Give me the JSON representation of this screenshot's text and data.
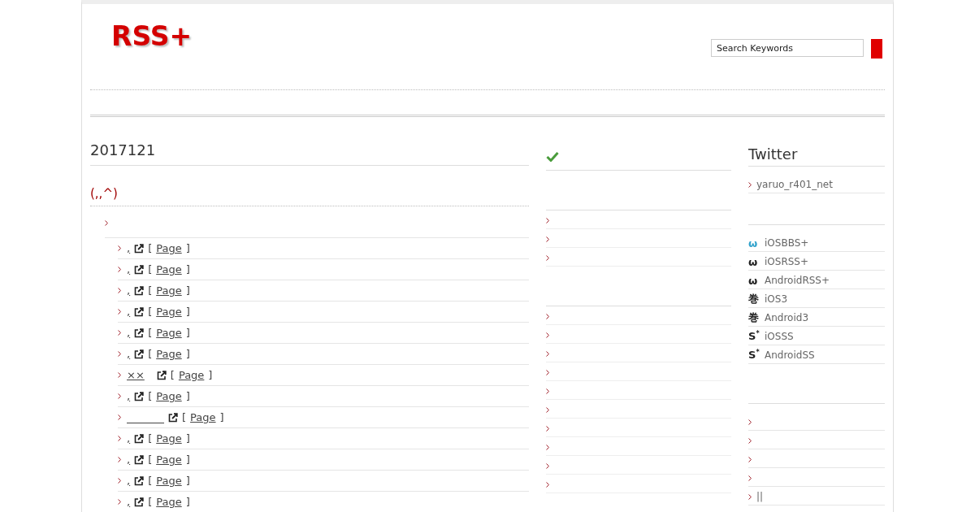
{
  "header": {
    "logo": "RSS+",
    "search": {
      "placeholder": "Search Keywords"
    }
  },
  "main": {
    "title": "2017121",
    "section_title": "(,,^)",
    "category": {
      "entries": [
        {
          "kind": "link",
          "title": ",",
          "open": "[",
          "link": "Page",
          "close": "]"
        },
        {
          "kind": "link",
          "title": ",",
          "open": "[",
          "link": "Page",
          "close": "]"
        },
        {
          "kind": "link",
          "title": ",",
          "open": "[",
          "link": "Page",
          "close": "]"
        },
        {
          "kind": "link",
          "title": ",",
          "open": "[",
          "link": "Page",
          "close": "]"
        },
        {
          "kind": "link",
          "title": ",",
          "open": "[",
          "link": "Page",
          "close": "]"
        },
        {
          "kind": "link",
          "title": ",",
          "open": "[",
          "link": "Page",
          "close": "]"
        },
        {
          "kind": "link",
          "title": "××",
          "open": "[",
          "link": "Page",
          "close": "]"
        },
        {
          "kind": "link",
          "title": ",",
          "open": "[",
          "link": "Page",
          "close": "]"
        },
        {
          "kind": "blank",
          "open": "[",
          "link": "Page",
          "close": "]"
        },
        {
          "kind": "link",
          "title": ",",
          "open": "[",
          "link": "Page",
          "close": "]"
        },
        {
          "kind": "link",
          "title": ",",
          "open": "[",
          "link": "Page",
          "close": "]"
        },
        {
          "kind": "link",
          "title": ",",
          "open": "[",
          "link": "Page",
          "close": "]"
        },
        {
          "kind": "link",
          "title": ",",
          "open": "[",
          "link": "Page",
          "close": "]"
        }
      ]
    }
  },
  "middle": {
    "lists": [
      [
        {
          "kind": "bullet"
        },
        {
          "kind": "bullet"
        },
        {
          "kind": "bullet"
        }
      ],
      [
        {
          "kind": "bullet"
        },
        {
          "kind": "bullet"
        },
        {
          "kind": "bullet"
        },
        {
          "kind": "bullet"
        },
        {
          "kind": "bullet"
        },
        {
          "kind": "bullet"
        },
        {
          "kind": "bullet"
        },
        {
          "kind": "bullet"
        },
        {
          "kind": "bullet"
        },
        {
          "kind": "bullet"
        }
      ]
    ]
  },
  "sidebar": {
    "title": "Twitter",
    "account": "yaruo_r401_net",
    "apps": [
      {
        "icon": "ω",
        "color": "#33a3cc",
        "label": "iOSBBS+"
      },
      {
        "icon": "ω",
        "color": "#222222",
        "label": "iOSRSS+"
      },
      {
        "icon": "ω",
        "color": "#222222",
        "label": "AndroidRSS+"
      },
      {
        "icon": "巻",
        "color": "#222222",
        "label": "iOS3"
      },
      {
        "icon": "巻",
        "color": "#222222",
        "label": "Android3"
      },
      {
        "icon": "S$^{*}$",
        "color": "#222222",
        "label": "iOSSS"
      },
      {
        "icon": "S$^{*}$",
        "color": "#222222",
        "label": "AndroidSS"
      }
    ],
    "links": [
      {
        "kind": "bullet"
      },
      {
        "kind": "bullet"
      },
      {
        "kind": "bullet"
      },
      {
        "kind": "bullet"
      },
      {
        "kind": "link",
        "label": "||"
      }
    ]
  }
}
